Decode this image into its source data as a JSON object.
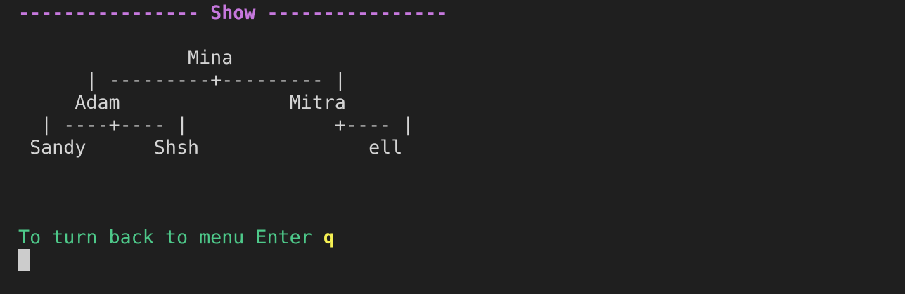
{
  "terminal": {
    "header": "---------------- Show ----------------",
    "tree_lines": [
      "               Mina",
      "      | ---------+--------- |",
      "     Adam               Mitra",
      "  | ----+---- |             +---- |",
      " Sandy      Shsh               ell"
    ],
    "prompt_text": "To turn back to menu Enter ",
    "prompt_key": "q"
  }
}
